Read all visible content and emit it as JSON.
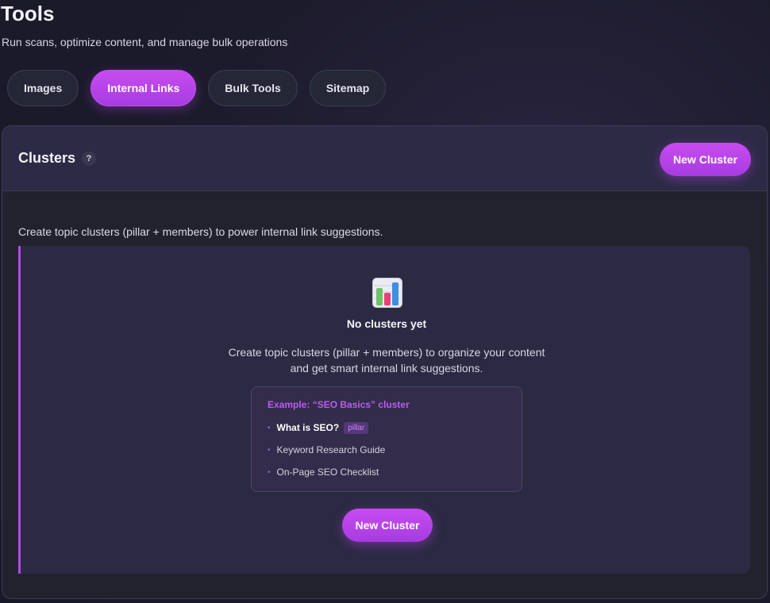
{
  "page": {
    "title": "Tools",
    "subtitle": "Run scans, optimize content, and manage bulk operations"
  },
  "tabs": [
    {
      "label": "Images",
      "active": false
    },
    {
      "label": "Internal Links",
      "active": true
    },
    {
      "label": "Bulk Tools",
      "active": false
    },
    {
      "label": "Sitemap",
      "active": false
    }
  ],
  "card": {
    "title": "Clusters",
    "help_label": "?",
    "new_cluster_label": "New Cluster",
    "description": "Create topic clusters (pillar + members) to power internal link suggestions."
  },
  "empty_state": {
    "icon": "bar-chart-icon",
    "title": "No clusters yet",
    "text_line1": "Create topic clusters (pillar + members) to organize your content",
    "text_line2": "and get smart internal link suggestions.",
    "example": {
      "title": "Example: “SEO Basics” cluster",
      "items": [
        {
          "label": "What is SEO?",
          "badge": "pillar"
        },
        {
          "label": "Keyword Research Guide"
        },
        {
          "label": "On-Page SEO Checklist"
        }
      ]
    },
    "button_label": "New Cluster"
  },
  "colors": {
    "accent": "#b04ae8",
    "background": "#1c1b2b",
    "card": "#22222f"
  }
}
